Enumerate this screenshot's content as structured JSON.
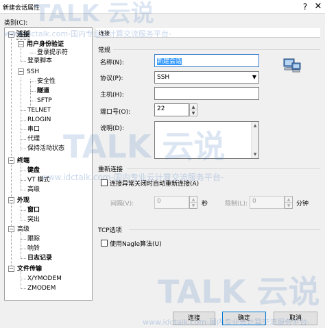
{
  "window": {
    "title": "新建会话属性",
    "help": "?",
    "close": "✕"
  },
  "category_label": "类别(C):",
  "tree": [
    {
      "label": "连接",
      "bold": true
    },
    {
      "label": "用户身份验证",
      "bold": true
    },
    {
      "label": "登录提示符"
    },
    {
      "label": "登录脚本"
    },
    {
      "label": "SSH"
    },
    {
      "label": "安全性"
    },
    {
      "label": "隧道",
      "bold": true
    },
    {
      "label": "SFTP"
    },
    {
      "label": "TELNET"
    },
    {
      "label": "RLOGIN"
    },
    {
      "label": "串口"
    },
    {
      "label": "代理"
    },
    {
      "label": "保持活动状态"
    },
    {
      "label": "终端",
      "bold": true
    },
    {
      "label": "键盘",
      "bold": true
    },
    {
      "label": "VT 模式"
    },
    {
      "label": "高级"
    },
    {
      "label": "外观",
      "bold": true
    },
    {
      "label": "窗口",
      "bold": true
    },
    {
      "label": "突出"
    },
    {
      "label": "高级"
    },
    {
      "label": "跟踪"
    },
    {
      "label": "响铃"
    },
    {
      "label": "日志记录",
      "bold": true
    },
    {
      "label": "文件传输",
      "bold": true
    },
    {
      "label": "X/YMODEM"
    },
    {
      "label": "ZMODEM"
    }
  ],
  "panel_header": "连接",
  "general": {
    "title": "常规",
    "name_label": "名称(N):",
    "name_value": "新建会话",
    "protocol_label": "协议(P):",
    "protocol_value": "SSH",
    "host_label": "主机(H):",
    "host_value": "",
    "port_label": "端口号(O):",
    "port_value": "22",
    "desc_label": "说明(D):",
    "desc_value": ""
  },
  "reconnect": {
    "title": "重新连接",
    "checkbox_label": "连接异常关闭时自动重新连接(A)",
    "interval_label": "间隔(V):",
    "interval_value": "0",
    "interval_unit": "秒",
    "limit_label": "限制(L):",
    "limit_value": "0",
    "limit_unit": "分钟"
  },
  "tcp": {
    "title": "TCP选项",
    "checkbox_label": "使用Nagle算法(U)"
  },
  "buttons": {
    "connect": "连接",
    "ok": "确定",
    "cancel": "取消"
  },
  "watermark": {
    "brand": "TALK 云说",
    "tagline": "www.idctalk.com-国内专业云计算交流服务平台-"
  }
}
